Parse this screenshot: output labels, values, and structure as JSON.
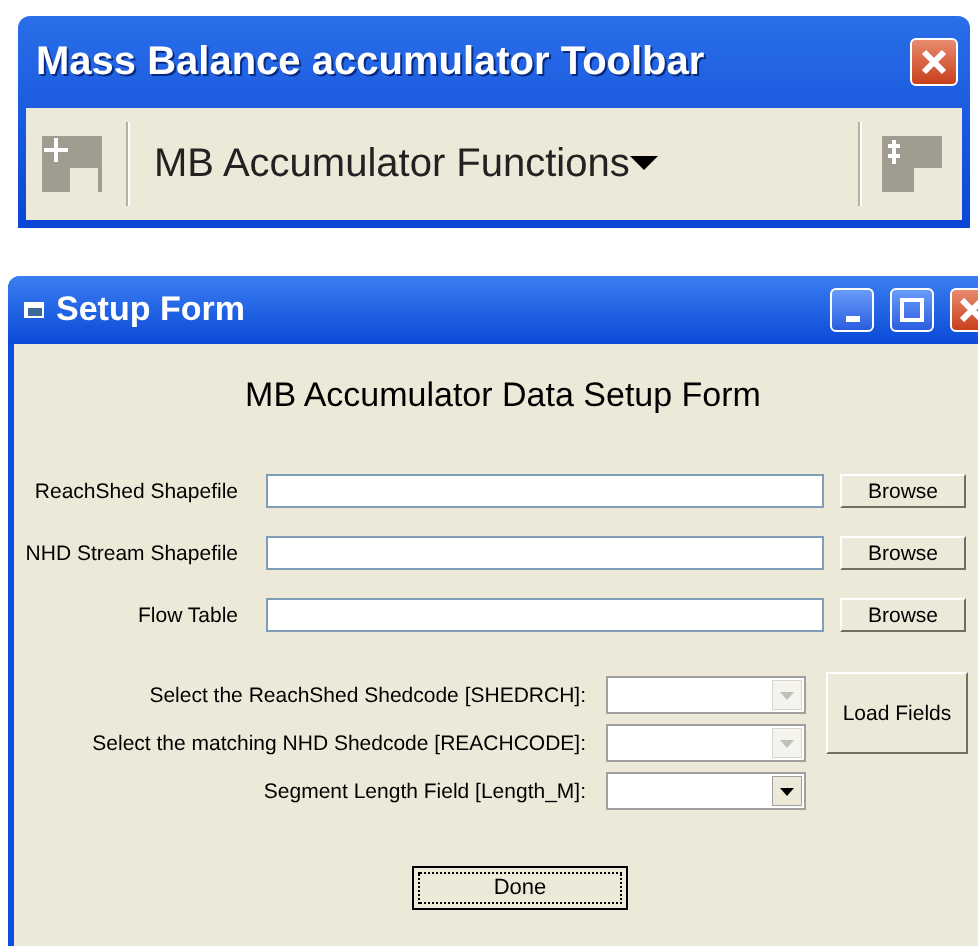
{
  "toolbar": {
    "title": "Mass Balance accumulator Toolbar",
    "menu": "MB Accumulator Functions"
  },
  "form": {
    "title": "Setup Form",
    "heading": "MB Accumulator Data Setup Form",
    "file_rows": [
      {
        "label": "ReachShed Shapefile",
        "button": "Browse"
      },
      {
        "label": "NHD Stream Shapefile",
        "button": "Browse"
      },
      {
        "label": "Flow Table",
        "button": "Browse"
      }
    ],
    "combo_rows": [
      {
        "label": "Select the ReachShed Shedcode [SHEDRCH]:",
        "disabled": true
      },
      {
        "label": "Select the matching NHD Shedcode [REACHCODE]:",
        "disabled": true
      },
      {
        "label": "Segment Length Field [Length_M]:",
        "disabled": false
      }
    ],
    "load_button": "Load Fields",
    "done_button": "Done"
  }
}
